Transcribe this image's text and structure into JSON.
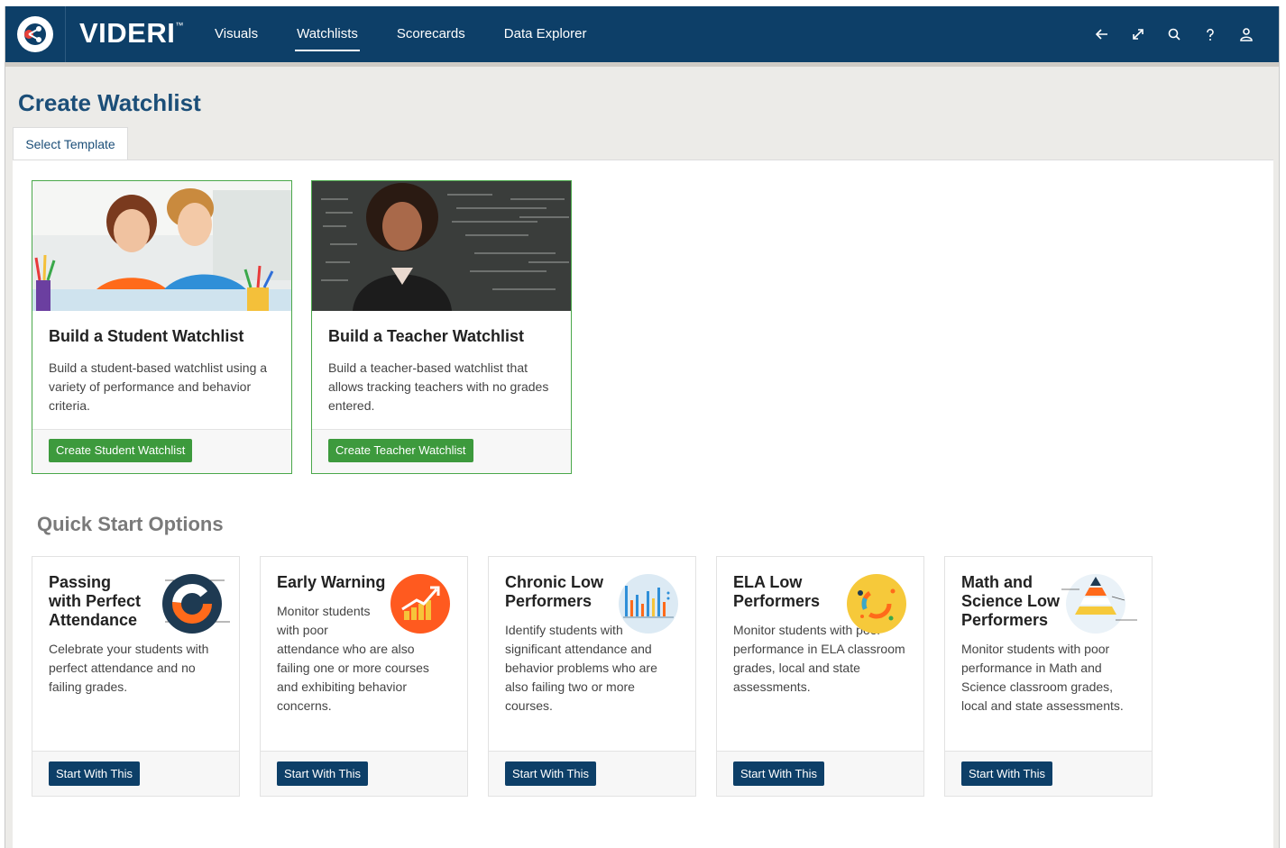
{
  "header": {
    "brand": "VIDERI",
    "brand_mark": "™",
    "nav": [
      {
        "label": "Visuals"
      },
      {
        "label": "Watchlists"
      },
      {
        "label": "Scorecards"
      },
      {
        "label": "Data Explorer"
      }
    ],
    "active_nav": "Watchlists",
    "icons": [
      "back-arrow-icon",
      "expand-icon",
      "search-icon",
      "help-icon",
      "user-icon"
    ]
  },
  "page": {
    "title": "Create Watchlist",
    "tab": "Select Template"
  },
  "templates": [
    {
      "title": "Build a Student Watchlist",
      "description": "Build a student-based watchlist using a variety of performance and behavior criteria.",
      "button": "Create Student Watchlist"
    },
    {
      "title": "Build a Teacher Watchlist",
      "description": "Build a teacher-based watchlist that allows tracking teachers with no grades entered.",
      "button": "Create Teacher Watchlist"
    }
  ],
  "quick_start": {
    "title": "Quick Start Options",
    "cards": [
      {
        "title": "Passing with Perfect Attendance",
        "description": "Celebrate your students with perfect attendance and no failing grades.",
        "button": "Start With This",
        "icon": "donut-chart-icon"
      },
      {
        "title": "Early Warning",
        "description": "Monitor students with poor attendance who are also failing one or more courses and exhibiting behavior concerns.",
        "button": "Start With This",
        "icon": "rising-bar-chart-icon"
      },
      {
        "title": "Chronic Low Performers",
        "description": "Identify students with significant attendance and behavior problems who are also failing two or more courses.",
        "button": "Start With This",
        "icon": "bar-chart-icon"
      },
      {
        "title": "ELA Low Performers",
        "description": "Monitor students with poor performance in ELA classroom grades, local and state assessments.",
        "button": "Start With This",
        "icon": "ring-chart-icon"
      },
      {
        "title": "Math and Science Low Performers",
        "description": "Monitor students with poor performance in Math and Science classroom grades, local and state assessments.",
        "button": "Start With This",
        "icon": "pyramid-chart-icon"
      }
    ]
  },
  "colors": {
    "header_bg": "#0d3f68",
    "accent_green": "#3d9a3d",
    "button_blue": "#0d3f68"
  }
}
